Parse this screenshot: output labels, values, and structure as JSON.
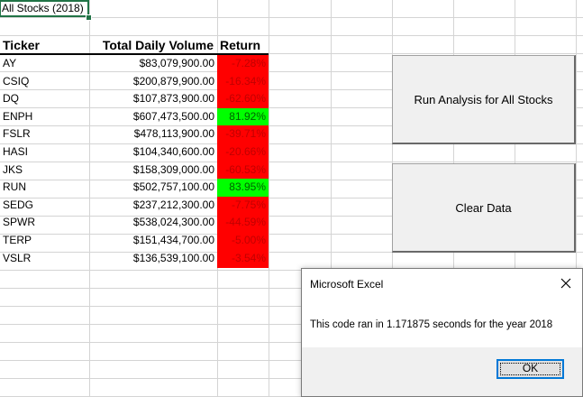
{
  "sheet": {
    "title_cell": "All Stocks (2018)",
    "headers": {
      "ticker": "Ticker",
      "volume": "Total Daily Volume",
      "return": "Return"
    },
    "rows": [
      {
        "ticker": "AY",
        "volume": "$83,079,900.00",
        "return": "-7.28%",
        "sign": "negative"
      },
      {
        "ticker": "CSIQ",
        "volume": "$200,879,900.00",
        "return": "-16.34%",
        "sign": "negative"
      },
      {
        "ticker": "DQ",
        "volume": "$107,873,900.00",
        "return": "-62.60%",
        "sign": "negative"
      },
      {
        "ticker": "ENPH",
        "volume": "$607,473,500.00",
        "return": "81.92%",
        "sign": "positive"
      },
      {
        "ticker": "FSLR",
        "volume": "$478,113,900.00",
        "return": "-39.71%",
        "sign": "negative"
      },
      {
        "ticker": "HASI",
        "volume": "$104,340,600.00",
        "return": "-20.66%",
        "sign": "negative"
      },
      {
        "ticker": "JKS",
        "volume": "$158,309,000.00",
        "return": "-60.53%",
        "sign": "negative"
      },
      {
        "ticker": "RUN",
        "volume": "$502,757,100.00",
        "return": "83.95%",
        "sign": "positive"
      },
      {
        "ticker": "SEDG",
        "volume": "$237,212,300.00",
        "return": "-7.75%",
        "sign": "negative"
      },
      {
        "ticker": "SPWR",
        "volume": "$538,024,300.00",
        "return": "-44.59%",
        "sign": "negative"
      },
      {
        "ticker": "TERP",
        "volume": "$151,434,700.00",
        "return": "-5.00%",
        "sign": "negative"
      },
      {
        "ticker": "VSLR",
        "volume": "$136,539,100.00",
        "return": "-3.54%",
        "sign": "negative"
      }
    ]
  },
  "buttons": {
    "run_label": "Run Analysis for All Stocks",
    "clear_label": "Clear Data"
  },
  "dialog": {
    "title": "Microsoft Excel",
    "message": "This code ran in 1.171875 seconds for the year 2018",
    "ok_label": "OK",
    "close_icon": "close-icon"
  },
  "colors": {
    "negative_fill": "#ff0000",
    "positive_fill": "#00ff00",
    "selection": "#217346",
    "gridline": "#d4d4d4"
  }
}
